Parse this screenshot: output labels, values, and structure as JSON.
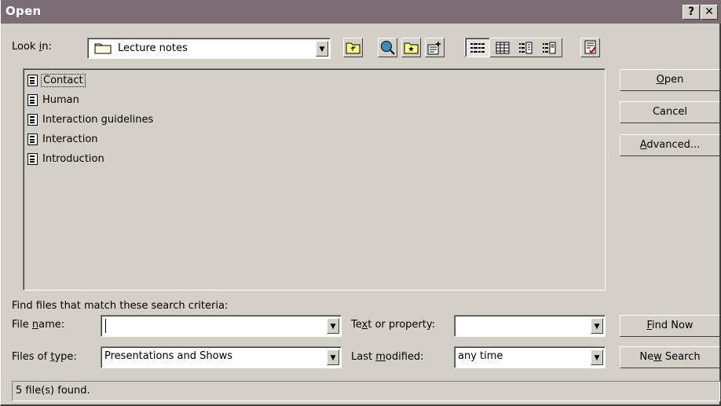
{
  "window": {
    "title": "Open",
    "help_label": "?",
    "close_label": "✕"
  },
  "look_in": {
    "label_pre": "Look ",
    "label_key": "i",
    "label_post": "n:",
    "value": "Lecture notes"
  },
  "files": [
    "Contact",
    "Human",
    "Interaction guidelines",
    "Interaction",
    "Introduction"
  ],
  "buttons": {
    "open": {
      "key": "O",
      "rest": "pen"
    },
    "cancel": {
      "label": "Cancel"
    },
    "advanced": {
      "key": "A",
      "rest": "dvanced..."
    },
    "find_now": {
      "key": "F",
      "rest": "ind Now"
    },
    "new_search": {
      "pre": "Ne",
      "key": "w",
      "rest": " Search"
    }
  },
  "search": {
    "heading": "Find files that match these search criteria:",
    "file_name": {
      "pre": "File ",
      "key": "n",
      "post": "ame:",
      "value": ""
    },
    "files_of_type": {
      "pre": "Files of ",
      "key": "t",
      "post": "ype:",
      "value": "Presentations and Shows"
    },
    "text_or_property": {
      "pre": "Te",
      "key": "x",
      "post": "t or property:",
      "value": ""
    },
    "last_modified": {
      "pre": "Last ",
      "key": "m",
      "post": "odified:",
      "value": "any time"
    }
  },
  "status": "5 file(s) found."
}
